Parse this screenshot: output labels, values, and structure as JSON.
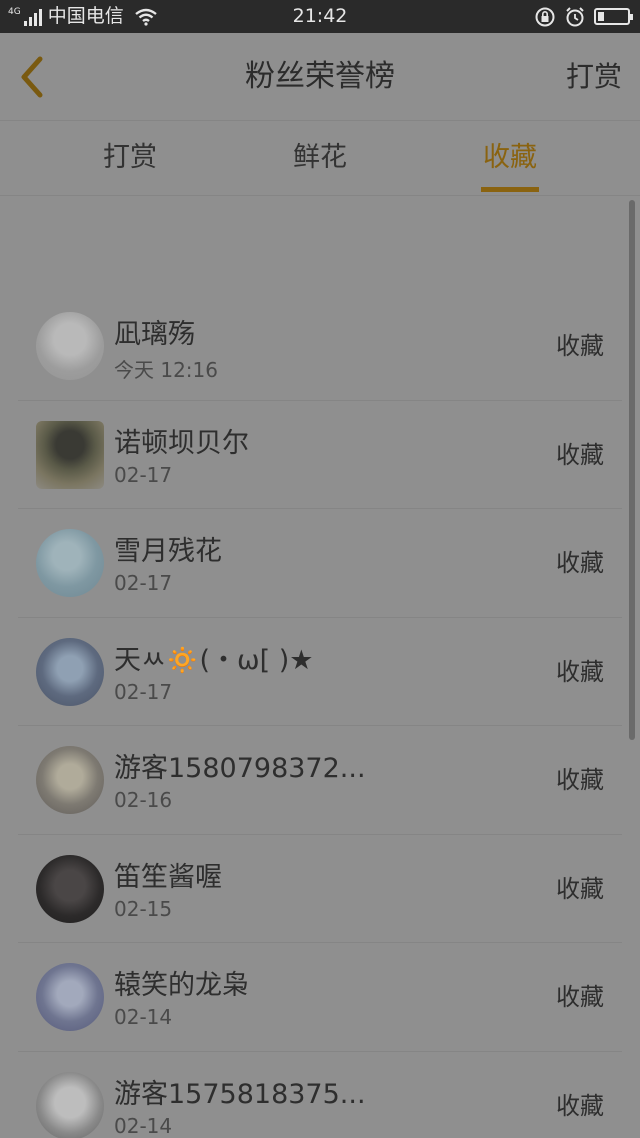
{
  "status_bar": {
    "network": "4G",
    "carrier": "中国电信",
    "time": "21:42",
    "battery_fraction": 0.2
  },
  "nav": {
    "title": "粉丝荣誉榜",
    "right_action": "打赏",
    "back_icon": "chevron-left-icon",
    "accent_color": "#8a6310"
  },
  "tabs": [
    {
      "label": "打赏",
      "active": false
    },
    {
      "label": "鲜花",
      "active": false
    },
    {
      "label": "收藏",
      "active": true
    }
  ],
  "list": [
    {
      "name": "凪璃殇",
      "date": "今天 12:16",
      "action": "收藏"
    },
    {
      "name": "诺顿坝贝尔",
      "date": "02-17",
      "action": "收藏"
    },
    {
      "name": "雪月残花",
      "date": "02-17",
      "action": "收藏"
    },
    {
      "name": "天ㅆ🔅(・ω[ )★",
      "date": "02-17",
      "action": "收藏"
    },
    {
      "name": "游客1580798372...",
      "date": "02-16",
      "action": "收藏"
    },
    {
      "name": "笛笙酱喔",
      "date": "02-15",
      "action": "收藏"
    },
    {
      "name": "辕笑的龙枭",
      "date": "02-14",
      "action": "收藏"
    },
    {
      "name": "游客1575818375...",
      "date": "02-14",
      "action": "收藏"
    }
  ]
}
